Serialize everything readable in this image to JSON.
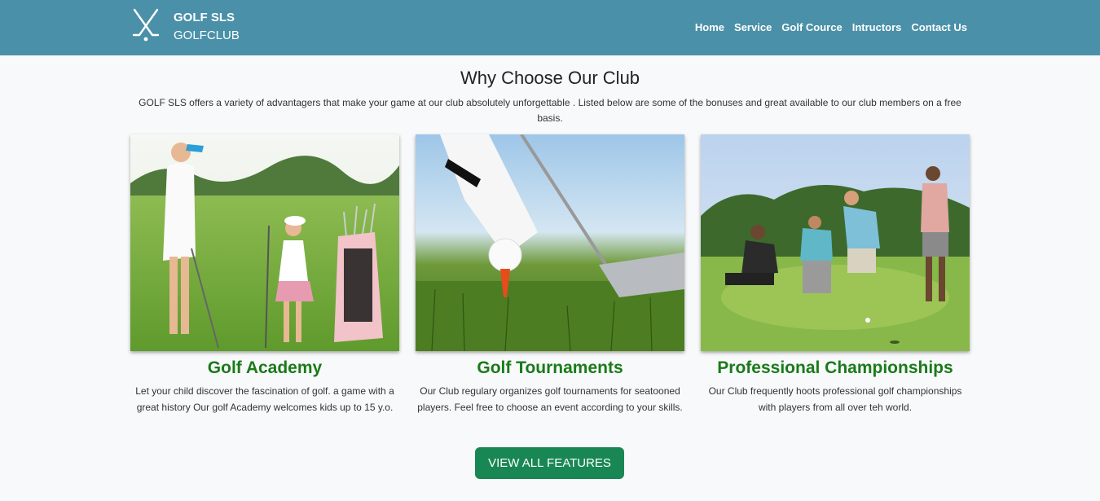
{
  "brand": {
    "title": "GOLF SLS",
    "subtitle": "GOLFCLUB",
    "icon": "golf-clubs-icon"
  },
  "nav": {
    "items": [
      {
        "label": "Home"
      },
      {
        "label": "Service"
      },
      {
        "label": "Golf Cource"
      },
      {
        "label": "Intructors"
      },
      {
        "label": "Contact Us"
      }
    ]
  },
  "main": {
    "title": "Why Choose Our Club",
    "intro": "GOLF SLS offers a variety of advantagers that make your game at our club absolutely unforgettable . Listed below are some of the bonuses and great available to our club members on a free basis.",
    "cards": [
      {
        "title": "Golf Academy",
        "text": "Let your child discover the fascination of golf. a game with a great history Our golf Academy welcomes kids up to 15 y.o."
      },
      {
        "title": "Golf Tournaments",
        "text": "Our Club regulary organizes golf tournaments for seatooned players. Feel free to choose an event according to your skills."
      },
      {
        "title": "Professional Championships",
        "text": "Our Club frequently hoots professional golf championships with players from all over teh world."
      }
    ],
    "cta_label": "VIEW ALL FEATURES"
  },
  "colors": {
    "header": "#4a90a8",
    "card_title": "#1a7a1a",
    "button": "#198754"
  }
}
